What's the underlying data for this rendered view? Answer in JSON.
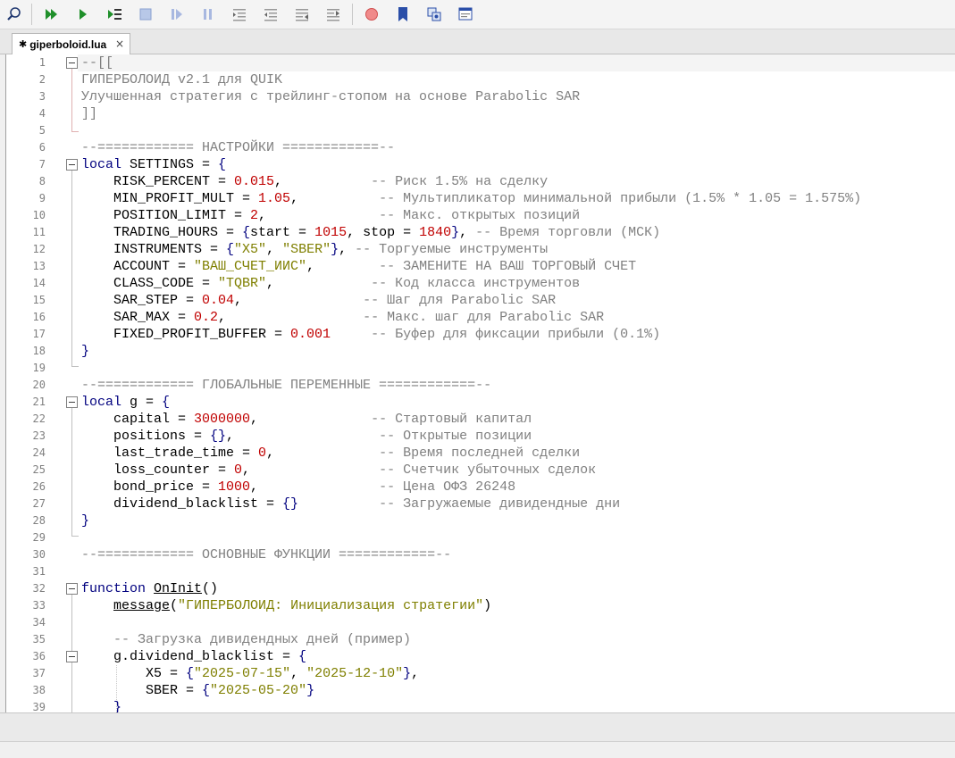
{
  "toolbar": {
    "buttons": [
      {
        "name": "find-icon"
      },
      {
        "name": "run-all-icon"
      },
      {
        "name": "run-icon"
      },
      {
        "name": "step-into-icon"
      },
      {
        "name": "stop-icon"
      },
      {
        "name": "step-over-icon"
      },
      {
        "name": "pause-icon"
      },
      {
        "name": "indent-icon"
      },
      {
        "name": "outdent-icon"
      },
      {
        "name": "comment-icon"
      },
      {
        "name": "uncomment-icon"
      },
      {
        "name": "breakpoint-icon"
      },
      {
        "name": "bookmark-icon"
      },
      {
        "name": "settings-icon"
      },
      {
        "name": "window-icon"
      }
    ]
  },
  "tab": {
    "label": "giperboloid.lua",
    "modified_marker": "✱",
    "close": "×"
  },
  "colors": {
    "comment": "#808080",
    "keyword": "#00007f",
    "number": "#c00000",
    "string": "#7f7f00"
  },
  "lines": [
    {
      "n": "1"
    },
    {
      "n": "2"
    },
    {
      "n": "3"
    },
    {
      "n": "4"
    },
    {
      "n": "5"
    },
    {
      "n": "6"
    },
    {
      "n": "7"
    },
    {
      "n": "8"
    },
    {
      "n": "9"
    },
    {
      "n": "10"
    },
    {
      "n": "11"
    },
    {
      "n": "12"
    },
    {
      "n": "13"
    },
    {
      "n": "14"
    },
    {
      "n": "15"
    },
    {
      "n": "16"
    },
    {
      "n": "17"
    },
    {
      "n": "18"
    },
    {
      "n": "19"
    },
    {
      "n": "20"
    },
    {
      "n": "21"
    },
    {
      "n": "22"
    },
    {
      "n": "23"
    },
    {
      "n": "24"
    },
    {
      "n": "25"
    },
    {
      "n": "26"
    },
    {
      "n": "27"
    },
    {
      "n": "28"
    },
    {
      "n": "29"
    },
    {
      "n": "30"
    },
    {
      "n": "31"
    },
    {
      "n": "32"
    },
    {
      "n": "33"
    },
    {
      "n": "34"
    },
    {
      "n": "35"
    },
    {
      "n": "36"
    },
    {
      "n": "37"
    },
    {
      "n": "38"
    },
    {
      "n": "39"
    }
  ],
  "code": {
    "l1": "--[[",
    "l2": "ГИПЕРБОЛОИД v2.1 для QUIK",
    "l3": "Улучшенная стратегия с трейлинг-стопом на основе Parabolic SAR",
    "l4": "]]",
    "l6": "--============ НАСТРОЙКИ ============--",
    "l7_kw": "local",
    "l7_rest": " SETTINGS = ",
    "l7_op": "{",
    "l8_a": "    RISK_PERCENT = ",
    "l8_num": "0.015",
    "l8_b": ",           ",
    "l8_cm": "-- Риск 1.5% на сделку",
    "l9_a": "    MIN_PROFIT_MULT = ",
    "l9_num": "1.05",
    "l9_b": ",          ",
    "l9_cm": "-- Мультипликатор минимальной прибыли (1.5% * 1.05 = 1.575%)",
    "l10_a": "    POSITION_LIMIT = ",
    "l10_num": "2",
    "l10_b": ",              ",
    "l10_cm": "-- Макс. открытых позиций",
    "l11_a": "    TRADING_HOURS = ",
    "l11_o1": "{",
    "l11_b": "start = ",
    "l11_n1": "1015",
    "l11_c": ", stop = ",
    "l11_n2": "1840",
    "l11_o2": "}",
    "l11_d": ", ",
    "l11_cm": "-- Время торговли (МСК)",
    "l12_a": "    INSTRUMENTS = ",
    "l12_o1": "{",
    "l12_s1": "\"X5\"",
    "l12_b": ", ",
    "l12_s2": "\"SBER\"",
    "l12_o2": "}",
    "l12_c": ", ",
    "l12_cm": "-- Торгуемые инструменты",
    "l13_a": "    ACCOUNT = ",
    "l13_str": "\"ВАШ_СЧЕТ_ИИС\"",
    "l13_b": ",        ",
    "l13_cm": "-- ЗАМЕНИТЕ НА ВАШ ТОРГОВЫЙ СЧЕТ",
    "l14_a": "    CLASS_CODE = ",
    "l14_str": "\"TQBR\"",
    "l14_b": ",            ",
    "l14_cm": "-- Код класса инструментов",
    "l15_a": "    SAR_STEP = ",
    "l15_num": "0.04",
    "l15_b": ",               ",
    "l15_cm": "-- Шаг для Parabolic SAR",
    "l16_a": "    SAR_MAX = ",
    "l16_num": "0.2",
    "l16_b": ",                 ",
    "l16_cm": "-- Макс. шаг для Parabolic SAR",
    "l17_a": "    FIXED_PROFIT_BUFFER = ",
    "l17_num": "0.001",
    "l17_b": "     ",
    "l17_cm": "-- Буфер для фиксации прибыли (0.1%)",
    "l18": "}",
    "l20": "--============ ГЛОБАЛЬНЫЕ ПЕРЕМЕННЫЕ ============--",
    "l21_kw": "local",
    "l21_rest": " g = ",
    "l21_op": "{",
    "l22_a": "    capital = ",
    "l22_num": "3000000",
    "l22_b": ",              ",
    "l22_cm": "-- Стартовый капитал",
    "l23_a": "    positions = ",
    "l23_op": "{}",
    "l23_b": ",                  ",
    "l23_cm": "-- Открытые позиции",
    "l24_a": "    last_trade_time = ",
    "l24_num": "0",
    "l24_b": ",             ",
    "l24_cm": "-- Время последней сделки",
    "l25_a": "    loss_counter = ",
    "l25_num": "0",
    "l25_b": ",                ",
    "l25_cm": "-- Счетчик убыточных сделок",
    "l26_a": "    bond_price = ",
    "l26_num": "1000",
    "l26_b": ",               ",
    "l26_cm": "-- Цена ОФЗ 26248",
    "l27_a": "    dividend_blacklist = ",
    "l27_op": "{}",
    "l27_b": "          ",
    "l27_cm": "-- Загружаемые дивидендные дни",
    "l28": "}",
    "l30": "--============ ОСНОВНЫЕ ФУНКЦИИ ============--",
    "l32_kw": "function",
    "l32_sp": " ",
    "l32_fn": "OnInit",
    "l32_rest": "()",
    "l33_a": "    ",
    "l33_fn": "message",
    "l33_b": "(",
    "l33_str": "\"ГИПЕРБОЛОИД: Инициализация стратегии\"",
    "l33_c": ")",
    "l35": "    -- Загрузка дивидендных дней (пример)",
    "l36_a": "    g.dividend_blacklist = ",
    "l36_op": "{",
    "l37_a": "        X5 = ",
    "l37_o1": "{",
    "l37_s1": "\"2025-07-15\"",
    "l37_b": ", ",
    "l37_s2": "\"2025-12-10\"",
    "l37_o2": "}",
    "l37_c": ",",
    "l38_a": "        SBER = ",
    "l38_o1": "{",
    "l38_s1": "\"2025-05-20\"",
    "l38_o2": "}",
    "l39": "    }"
  }
}
